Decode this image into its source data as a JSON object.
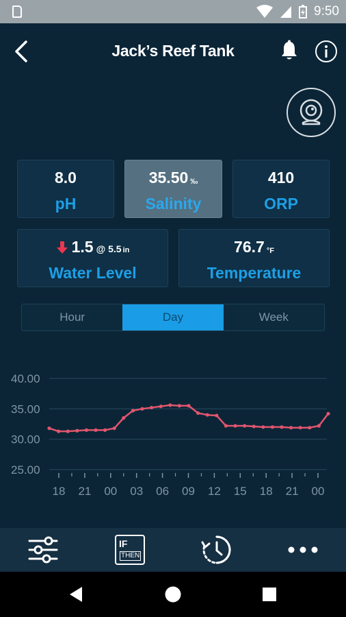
{
  "status_bar": {
    "time": "9:50"
  },
  "header": {
    "title": "Jack’s Reef Tank"
  },
  "cards": {
    "ph": {
      "value": "8.0",
      "label": "pH"
    },
    "salinity": {
      "value": "35.50",
      "unit": "‰",
      "label": "Salinity"
    },
    "orp": {
      "value": "410",
      "label": "ORP"
    },
    "water_level": {
      "value": "1.5",
      "at": "@ 5.5",
      "unit": "in",
      "label": "Water Level"
    },
    "temperature": {
      "value": "76.7",
      "unit": "°F",
      "label": "Temperature"
    }
  },
  "range_tabs": [
    "Hour",
    "Day",
    "Week"
  ],
  "selected_range": "Day",
  "chart_data": {
    "type": "line",
    "title": "",
    "xlabel": "",
    "ylabel": "",
    "y_ticks": [
      "40.00",
      "35.00",
      "30.00",
      "25.00"
    ],
    "ylim": [
      25,
      40
    ],
    "x_ticks": [
      "18",
      "21",
      "00",
      "03",
      "06",
      "09",
      "12",
      "15",
      "18",
      "21",
      "00"
    ],
    "series": [
      {
        "color": "#e0566e",
        "x": [
          0,
          1,
          2,
          3,
          4,
          5,
          6,
          7,
          8,
          9,
          10,
          11,
          12,
          13,
          14,
          15,
          16,
          17,
          18,
          19,
          20,
          21,
          22,
          23,
          24,
          25,
          26,
          27,
          28,
          29,
          30
        ],
        "values": [
          31.8,
          31.3,
          31.3,
          31.4,
          31.5,
          31.5,
          31.5,
          31.8,
          33.5,
          34.7,
          35.0,
          35.2,
          35.4,
          35.6,
          35.5,
          35.5,
          34.3,
          34.0,
          33.9,
          32.2,
          32.2,
          32.2,
          32.1,
          32.0,
          32.0,
          32.0,
          31.9,
          31.9,
          31.9,
          32.2,
          34.2
        ]
      }
    ],
    "grid": true
  },
  "bottom_nav": {
    "filters": "filters-icon",
    "if_then_line1": "IF",
    "if_then_line2": "THEN",
    "history": "history-icon",
    "more": "more-icon"
  }
}
